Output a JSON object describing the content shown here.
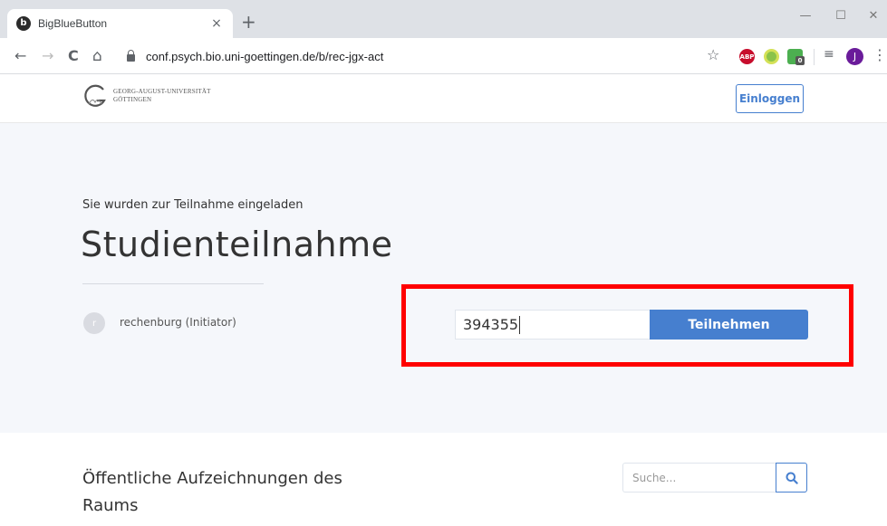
{
  "browser": {
    "tab": {
      "title": "BigBlueButton",
      "favicon_letter": "b",
      "close": "×"
    },
    "new_tab": "+",
    "window": {
      "minimize": "—",
      "maximize": "☐",
      "close": "✕"
    },
    "nav": {
      "back": "←",
      "forward": "→",
      "reload": "C",
      "home": "⌂"
    },
    "address": "conf.psych.bio.uni-goettingen.de/b/rec-jgx-act",
    "bookmark": "☆",
    "extensions": {
      "abp": "ABP",
      "check_badge": "0"
    },
    "profile_initial": "J",
    "menu": "⋮",
    "reading_list": "≡"
  },
  "header": {
    "logo_line1": "GEORG-AUGUST-UNIVERSITÄT",
    "logo_line2": "GÖTTINGEN",
    "login_label": "Einloggen"
  },
  "room": {
    "invite_text": "Sie wurden zur Teilnahme eingeladen",
    "title": "Studienteilnahme",
    "owner_initial": "r",
    "owner_name": "rechenburg (Initiator)",
    "join_value": "394355",
    "join_label": "Teilnehmen"
  },
  "recordings": {
    "title": "Öffentliche Aufzeichnungen des Raums",
    "search_placeholder": "Suche..."
  },
  "colors": {
    "primary": "#467fcf",
    "highlight": "#ff0000",
    "hero_bg": "#f5f7fb"
  }
}
